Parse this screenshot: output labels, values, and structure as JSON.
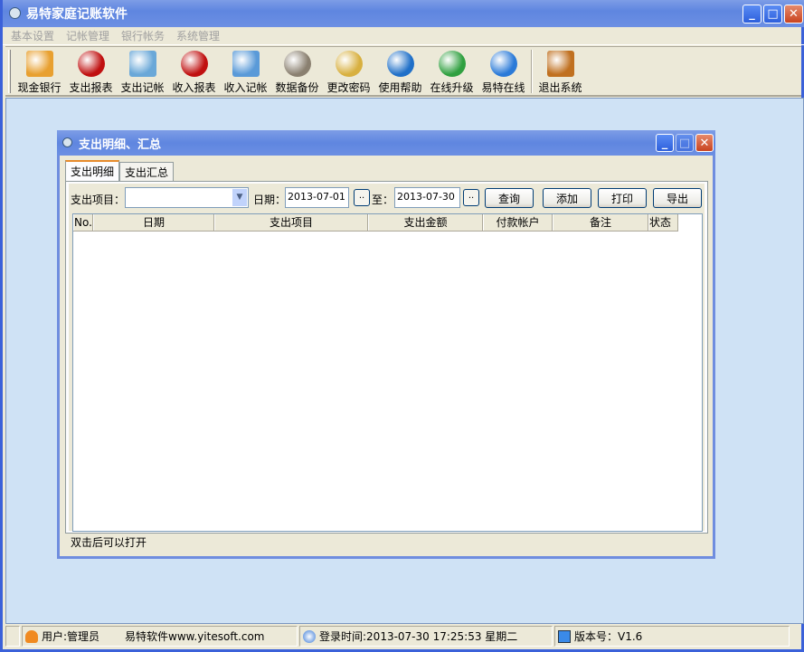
{
  "app": {
    "title": "易特家庭记账软件"
  },
  "menu": [
    "基本设置",
    "记帐管理",
    "银行帐务",
    "系统管理"
  ],
  "toolbar": [
    {
      "label": "现金银行",
      "icon": "cash-bank-icon",
      "color": "#e8a030"
    },
    {
      "label": "支出报表",
      "icon": "expense-report-icon",
      "color": "#c01010"
    },
    {
      "label": "支出记帐",
      "icon": "expense-entry-icon",
      "color": "#6aa8d8"
    },
    {
      "label": "收入报表",
      "icon": "income-report-icon",
      "color": "#c01010"
    },
    {
      "label": "收入记帐",
      "icon": "income-entry-icon",
      "color": "#5a9ad8"
    },
    {
      "label": "数据备份",
      "icon": "data-backup-icon",
      "color": "#8a8070"
    },
    {
      "label": "更改密码",
      "icon": "key-icon",
      "color": "#d8b040"
    },
    {
      "label": "使用帮助",
      "icon": "help-icon",
      "color": "#2070c8"
    },
    {
      "label": "在线升级",
      "icon": "online-upgrade-icon",
      "color": "#30a040"
    },
    {
      "label": "易特在线",
      "icon": "ie-icon",
      "color": "#2a7ad8"
    },
    {
      "label": "退出系统",
      "icon": "exit-icon",
      "color": "#c07020"
    }
  ],
  "child": {
    "title": "支出明细、汇总",
    "tabs": [
      "支出明细",
      "支出汇总"
    ],
    "filter": {
      "item_label": "支出项目：",
      "item_value": "",
      "date_label": "日期：",
      "date_from": "2013-07-01",
      "to_label": "至：",
      "date_to": "2013-07-30",
      "picker": ".."
    },
    "buttons": [
      "查询",
      "添加",
      "打印",
      "导出"
    ],
    "columns": [
      "No.",
      "日期",
      "支出项目",
      "支出金额",
      "付款帐户",
      "备注",
      "状态"
    ],
    "status": "双击后可以打开"
  },
  "statusbar": {
    "user": "用户:管理员",
    "company": "易特软件www.yitesoft.com",
    "login": "登录时间:2013-07-30 17:25:53 星期二",
    "version": "版本号：V1.6"
  }
}
